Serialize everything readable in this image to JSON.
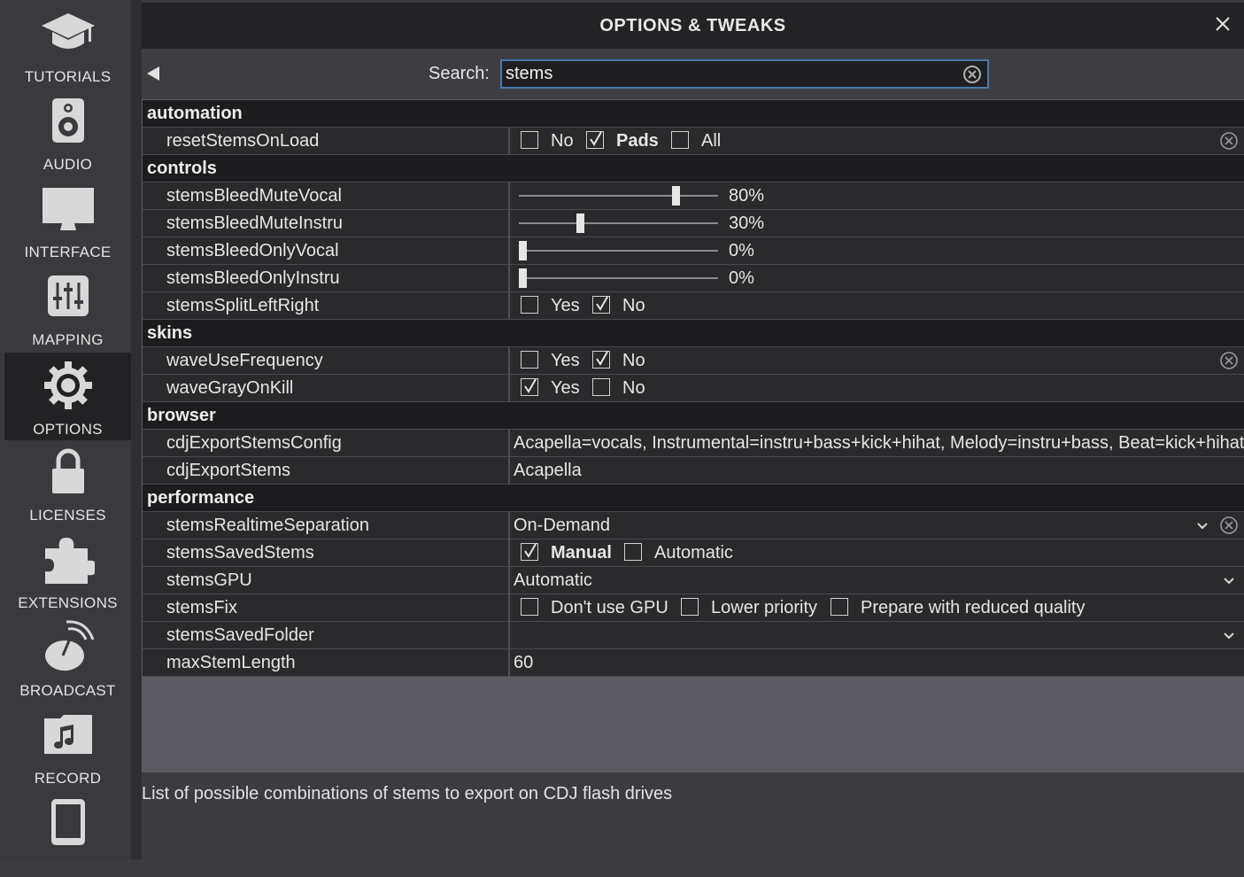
{
  "sidebar": {
    "items": [
      {
        "label": "TUTORIALS",
        "icon": "graduation-cap-icon"
      },
      {
        "label": "AUDIO",
        "icon": "speaker-icon"
      },
      {
        "label": "INTERFACE",
        "icon": "monitor-icon"
      },
      {
        "label": "MAPPING",
        "icon": "sliders-icon"
      },
      {
        "label": "OPTIONS",
        "icon": "gear-icon",
        "active": true
      },
      {
        "label": "LICENSES",
        "icon": "lock-icon"
      },
      {
        "label": "EXTENSIONS",
        "icon": "puzzle-icon"
      },
      {
        "label": "BROADCAST",
        "icon": "satellite-dish-icon"
      },
      {
        "label": "RECORD",
        "icon": "music-folder-icon"
      },
      {
        "label": "",
        "icon": "tablet-icon"
      }
    ]
  },
  "header": {
    "title": "OPTIONS & TWEAKS"
  },
  "search": {
    "label": "Search:",
    "value": "stems"
  },
  "categories": {
    "automation": "automation",
    "controls": "controls",
    "skins": "skins",
    "browser": "browser",
    "performance": "performance"
  },
  "options": {
    "resetStemsOnLoad": {
      "name": "resetStemsOnLoad",
      "choices": [
        "No",
        "Pads",
        "All"
      ],
      "selected": "Pads"
    },
    "stemsBleedMuteVocal": {
      "name": "stemsBleedMuteVocal",
      "value": 0.8,
      "display": "80%"
    },
    "stemsBleedMuteInstru": {
      "name": "stemsBleedMuteInstru",
      "value": 0.3,
      "display": "30%"
    },
    "stemsBleedOnlyVocal": {
      "name": "stemsBleedOnlyVocal",
      "value": 0,
      "display": "0%"
    },
    "stemsBleedOnlyInstru": {
      "name": "stemsBleedOnlyInstru",
      "value": 0,
      "display": "0%"
    },
    "stemsSplitLeftRight": {
      "name": "stemsSplitLeftRight",
      "choices": [
        "Yes",
        "No"
      ],
      "selected": "No"
    },
    "waveUseFrequency": {
      "name": "waveUseFrequency",
      "choices": [
        "Yes",
        "No"
      ],
      "selected": "No"
    },
    "waveGrayOnKill": {
      "name": "waveGrayOnKill",
      "choices": [
        "Yes",
        "No"
      ],
      "selected": "Yes"
    },
    "cdjExportStemsConfig": {
      "name": "cdjExportStemsConfig",
      "value": "Acapella=vocals, Instrumental=instru+bass+kick+hihat, Melody=instru+bass, Beat=kick+hihat"
    },
    "cdjExportStems": {
      "name": "cdjExportStems",
      "value": "Acapella"
    },
    "stemsRealtimeSeparation": {
      "name": "stemsRealtimeSeparation",
      "value": "On-Demand"
    },
    "stemsSavedStems": {
      "name": "stemsSavedStems",
      "choices": [
        "Manual",
        "Automatic"
      ],
      "selected": "Manual"
    },
    "stemsGPU": {
      "name": "stemsGPU",
      "value": "Automatic"
    },
    "stemsFix": {
      "name": "stemsFix",
      "choices": [
        "Don't use GPU",
        "Lower priority",
        "Prepare with reduced quality"
      ],
      "selected": ""
    },
    "stemsSavedFolder": {
      "name": "stemsSavedFolder",
      "value": ""
    },
    "maxStemLength": {
      "name": "maxStemLength",
      "value": "60"
    }
  },
  "footer": {
    "description": "List of possible combinations of stems to export on CDJ flash drives"
  },
  "colors": {
    "accent": "#4a78a8",
    "active_nav": "#222225",
    "row_bg": "#2a2a2d",
    "category_bg": "#1c1c1f"
  }
}
